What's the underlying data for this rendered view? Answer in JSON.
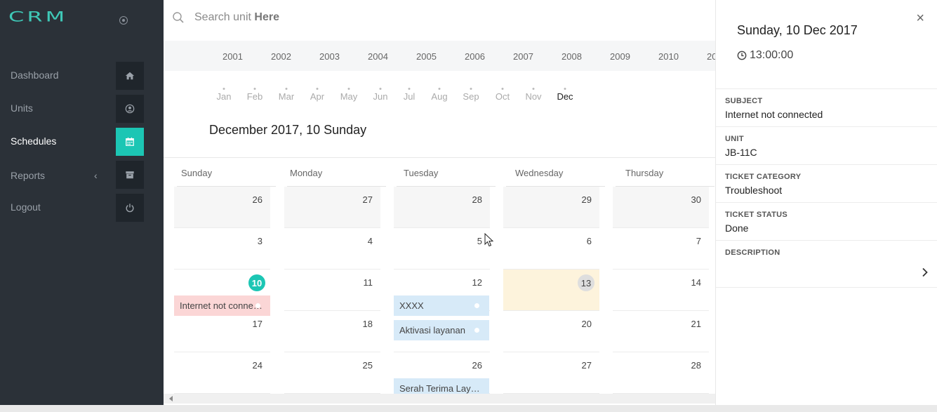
{
  "sidebar": {
    "logo_text": "CRM",
    "items": [
      {
        "label": "Dashboard",
        "icon": "home-icon"
      },
      {
        "label": "Units",
        "icon": "user-circle-icon"
      },
      {
        "label": "Schedules",
        "icon": "calendar-icon"
      },
      {
        "label": "Reports",
        "icon": "archive-icon"
      },
      {
        "label": "Logout",
        "icon": "power-icon"
      }
    ],
    "active_item": "Schedules",
    "accent_color": "#1cc6b4",
    "background_color": "#2b3138"
  },
  "search": {
    "placeholder_prefix": "Search unit ",
    "placeholder_bold": "Here"
  },
  "years": [
    "2001",
    "2002",
    "2003",
    "2004",
    "2005",
    "2006",
    "2007",
    "2008",
    "2009",
    "2010",
    "20"
  ],
  "months": [
    "Jan",
    "Feb",
    "Mar",
    "Apr",
    "May",
    "Jun",
    "Jul",
    "Aug",
    "Sep",
    "Oct",
    "Nov",
    "Dec"
  ],
  "selected_month": "Dec",
  "calendar": {
    "heading": "December 2017, 10 Sunday",
    "weekdays": [
      "Sunday",
      "Monday",
      "Tuesday",
      "Wednesday",
      "Thursday"
    ],
    "weeks": [
      [
        "26",
        "27",
        "28",
        "29",
        "30"
      ],
      [
        "3",
        "4",
        "5",
        "6",
        "7"
      ],
      [
        "10",
        "11",
        "12",
        "13",
        "14"
      ],
      [
        "17",
        "18",
        "19",
        "20",
        "21"
      ],
      [
        "24",
        "25",
        "26",
        "27",
        "28"
      ]
    ],
    "today": "10",
    "events": [
      {
        "title": "Internet not connected",
        "color": "#fbd6d6"
      },
      {
        "title": "XXXX",
        "color": "#d7eaf8"
      },
      {
        "title": "Aktivasi layanan",
        "color": "#d7eaf8"
      },
      {
        "title": "Serah Terima Layanan",
        "color": "#d7eaf8"
      }
    ]
  },
  "detail_panel": {
    "close_label": "×",
    "date": "Sunday, 10 Dec 2017",
    "time": "13:00:00",
    "fields": [
      {
        "label": "SUBJECT",
        "value": "Internet not connected"
      },
      {
        "label": "UNIT",
        "value": "JB-11C"
      },
      {
        "label": "TICKET CATEGORY",
        "value": "Troubleshoot"
      },
      {
        "label": "TICKET STATUS",
        "value": "Done"
      },
      {
        "label": "DESCRIPTION",
        "value": ""
      }
    ]
  }
}
